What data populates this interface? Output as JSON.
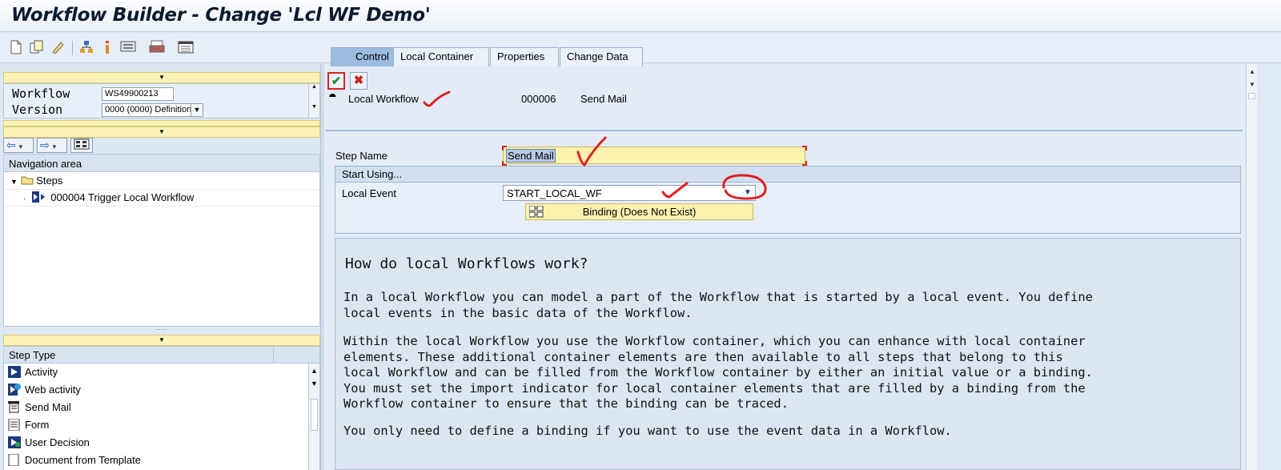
{
  "window": {
    "title": "Workflow Builder - Change 'Lcl WF Demo'"
  },
  "toolbar": {
    "icons": [
      "new-document-icon",
      "copy-icon",
      "edit-icon",
      "hierarchy-icon",
      "info-icon",
      "display-icon",
      "print-icon",
      "layout-icon"
    ]
  },
  "workflow_form": {
    "workflow_label": "Workflow",
    "workflow_value": "WS49900213",
    "version_label": "Version",
    "version_value": "0000 (0000) Definition"
  },
  "navigation": {
    "header": "Navigation area",
    "root_label": "Steps",
    "items": [
      {
        "label": "000004 Trigger Local Workflow"
      }
    ]
  },
  "step_types": {
    "header": "Step Type",
    "items": [
      {
        "label": "Activity"
      },
      {
        "label": "Web activity"
      },
      {
        "label": "Send Mail"
      },
      {
        "label": "Form"
      },
      {
        "label": "User Decision"
      },
      {
        "label": "Document from Template"
      }
    ]
  },
  "detail_header": {
    "type": "Local Workflow",
    "number": "000006",
    "name": "Send Mail"
  },
  "tabs": [
    {
      "label": "Control"
    },
    {
      "label": "Local Container"
    },
    {
      "label": "Properties"
    },
    {
      "label": "Change Data"
    }
  ],
  "control": {
    "step_name_label": "Step Name",
    "step_name_value": "Send Mail",
    "start_group_title": "Start Using...",
    "local_event_label": "Local Event",
    "local_event_value": "START_LOCAL_WF",
    "binding_button": "Binding (Does Not Exist)"
  },
  "doc": {
    "heading": "How do local Workflows work?",
    "p1": "In a local Workflow you can model a part of the Workflow that is started by a local event. You define\nlocal events in the basic data of the Workflow.",
    "p2": "Within the local Workflow you use the Workflow container, which you can enhance with local container\nelements. These additional container elements are then available to all steps that belong to this\nlocal Workflow and can be filled from the Workflow container by either an initial value or a binding.\nYou must set the import indicator for local container elements that are filled by a binding from the\nWorkflow container to ensure that the binding can be traced.",
    "p3": "You only need to define a binding if you want to use the event data in a Workflow."
  },
  "colors": {
    "accent_tab": "#9bbbe0",
    "highlight_field": "#fbf2b0",
    "annotation_red": "#e02020"
  }
}
